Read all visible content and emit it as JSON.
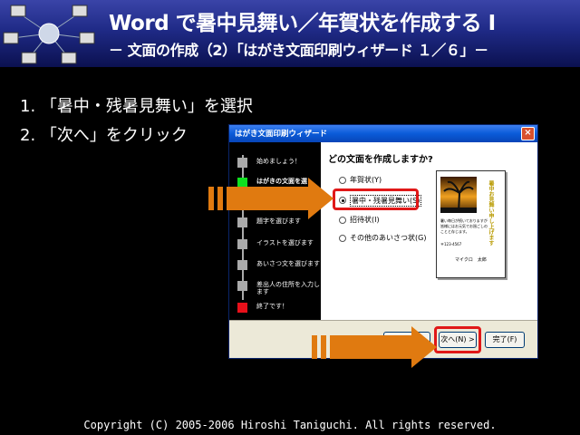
{
  "header": {
    "title": "Word で暑中見舞い／年賀状を作成する I",
    "subtitle": "－ 文面の作成（2）「はがき文面印刷ウィザード １／６」－"
  },
  "steps": [
    "1. 「暑中・残暑見舞い」を選択",
    "2. 「次へ」をクリック"
  ],
  "wizard": {
    "title": "はがき文面印刷ウィザード",
    "close_label": "×",
    "sidebar": [
      {
        "label": "始めましょう！",
        "state": "gray"
      },
      {
        "label": "はがきの文面を選",
        "state": "green"
      },
      {
        "label": "題字を選びます",
        "state": "gray"
      },
      {
        "label": "イラストを選びます",
        "state": "gray"
      },
      {
        "label": "あいさつ文を選びます",
        "state": "gray"
      },
      {
        "label": "差出人の住所を入力します",
        "state": "gray"
      },
      {
        "label": "終了です！",
        "state": "red"
      }
    ],
    "question": "どの文面を作成しますか?",
    "options": [
      {
        "label": "年賀状(Y)",
        "selected": false
      },
      {
        "label": "暑中・残暑見舞い(S)",
        "selected": true
      },
      {
        "label": "招待状(I)",
        "selected": false
      },
      {
        "label": "その他のあいさつ状(G)",
        "selected": false
      }
    ],
    "preview": {
      "vertical_text": "暑中お見舞い申し上げます",
      "lines": [
        "暑い毎日が続いておりますが",
        "皆様にはお元気でお過ごしの",
        "ことと存じます。"
      ],
      "postal": "〒123-4567",
      "name": "マイクロ　太郎"
    },
    "buttons": {
      "back": "< 戻る(B)",
      "next": "次へ(N) >",
      "finish": "完了(F)"
    }
  },
  "colors": {
    "highlight": "#e01818",
    "arrow": "#e07a10"
  },
  "copyright": "Copyright (C) 2005-2006 Hiroshi Taniguchi. All rights reserved."
}
